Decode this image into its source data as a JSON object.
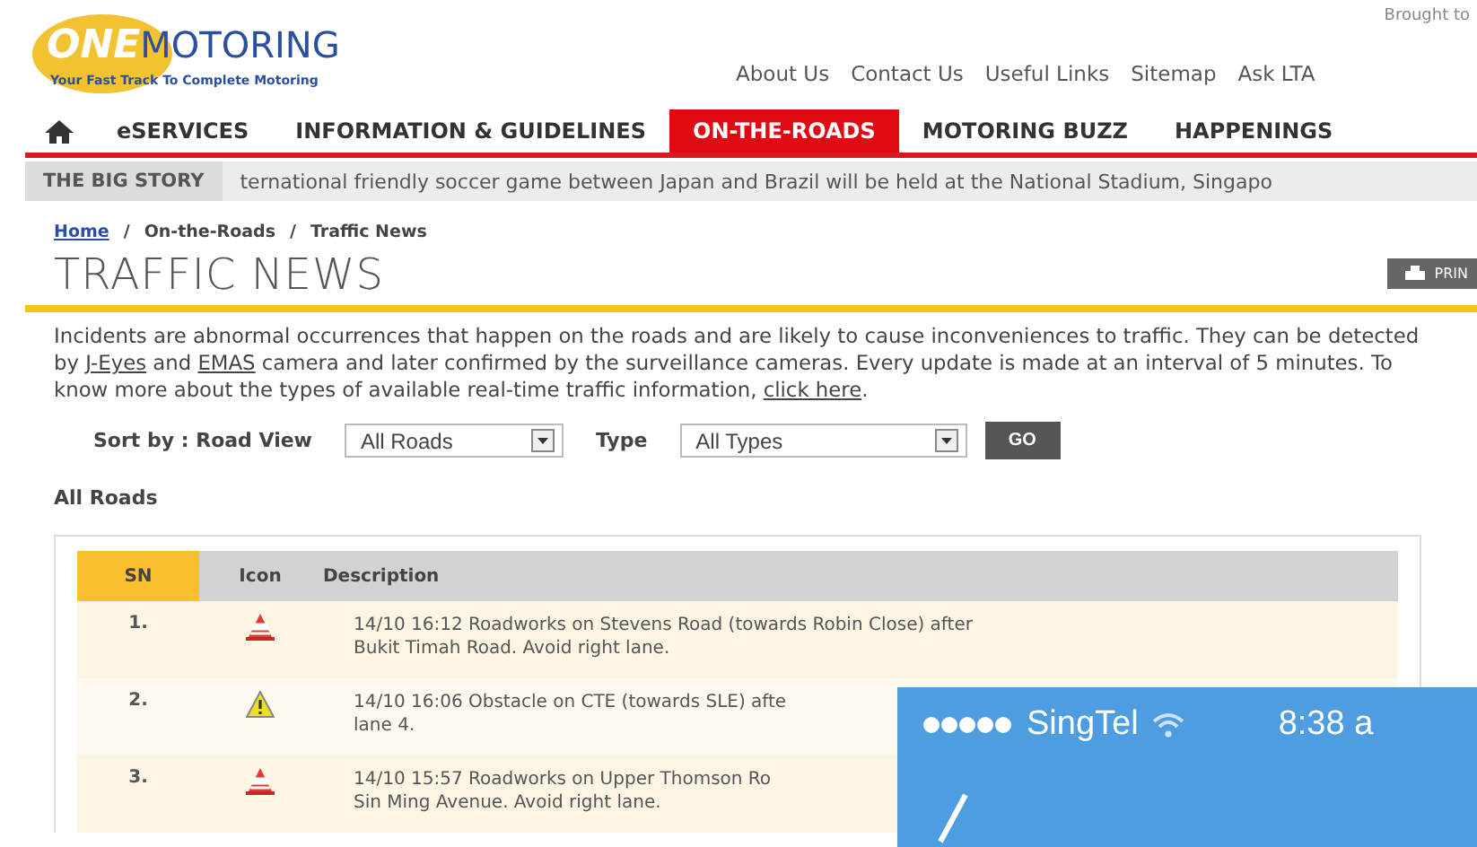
{
  "header": {
    "logo": {
      "brand_highlight": "ONE",
      "brand": "MOTORING",
      "tagline": "Your Fast Track To Complete Motoring"
    },
    "brought_to": "Brought to",
    "links": [
      "About Us",
      "Contact Us",
      "Useful Links",
      "Sitemap",
      "Ask LTA"
    ]
  },
  "nav": [
    {
      "label": "eSERVICES",
      "selected": false
    },
    {
      "label": "INFORMATION & GUIDELINES",
      "selected": false
    },
    {
      "label": "ON-THE-ROADS",
      "selected": true
    },
    {
      "label": "MOTORING BUZZ",
      "selected": false
    },
    {
      "label": "HAPPENINGS",
      "selected": false
    }
  ],
  "big_story": {
    "label": "THE BIG STORY",
    "text": "ternational friendly soccer game between Japan and Brazil will be held at the National Stadium, Singapo"
  },
  "breadcrumb": [
    "Home",
    "On-the-Roads",
    "Traffic News"
  ],
  "breadcrumb_separator": "/",
  "page_title": "TRAFFIC NEWS",
  "print_button": "PRIN",
  "intro": [
    {
      "kind": "text",
      "text": "Incidents are abnormal occurrences that happen on the roads and are likely to cause inconveniences to traffic. They can be detected by "
    },
    {
      "kind": "link",
      "text": "J-Eyes"
    },
    {
      "kind": "text",
      "text": " and "
    },
    {
      "kind": "link",
      "text": "EMAS"
    },
    {
      "kind": "text",
      "text": " camera and later confirmed by the surveillance cameras. Every update is made at an interval of 5 minutes. To know more about the types of available real-time traffic information, "
    },
    {
      "kind": "link",
      "text": "click here"
    },
    {
      "kind": "text",
      "text": "."
    }
  ],
  "filters": {
    "sort_label": "Sort by : Road View",
    "road": "All Roads",
    "type_label": "Type",
    "type": "All Types",
    "go": "GO"
  },
  "section_title": "All Roads",
  "table": {
    "columns": [
      "SN",
      "Icon",
      "Description"
    ],
    "rows": [
      {
        "sn": "1.",
        "kind": "roadworks",
        "lines": [
          "14/10 16:12 Roadworks on Stevens Road (towards Robin Close) after",
          "Bukit Timah Road. Avoid right lane."
        ]
      },
      {
        "sn": "2.",
        "kind": "obstacle",
        "lines": [
          "14/10 16:06 Obstacle on CTE (towards SLE) afte",
          "lane 4."
        ]
      },
      {
        "sn": "3.",
        "kind": "roadworks",
        "lines": [
          "14/10 15:57 Roadworks on Upper Thomson Ro",
          "Sin Ming Avenue. Avoid right lane."
        ]
      }
    ]
  },
  "phone_overlay": {
    "carrier": "SingTel",
    "time": "8:38 a"
  }
}
